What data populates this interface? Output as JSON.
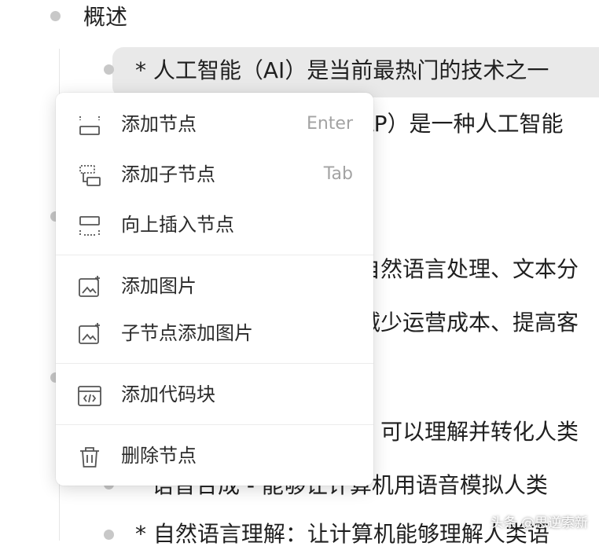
{
  "outline": {
    "title": "概述",
    "lines": [
      "* 人工智能（AI）是当前最热门的技术之一",
      "LP）是一种人工智能",
      "自然语言处理、文本分",
      "减少运营成本、提高客",
      "，可以理解并转化人类",
      "语音合成 - 能够让计算机用语音模拟人类",
      "* 自然语言理解：让计算机能够理解人类语"
    ]
  },
  "menu": {
    "items": [
      {
        "label": "添加节点",
        "shortcut": "Enter",
        "icon": "add-node-icon"
      },
      {
        "label": "添加子节点",
        "shortcut": "Tab",
        "icon": "add-child-node-icon"
      },
      {
        "label": "向上插入节点",
        "shortcut": "",
        "icon": "insert-above-icon"
      },
      {
        "label": "添加图片",
        "shortcut": "",
        "icon": "image-icon"
      },
      {
        "label": "子节点添加图片",
        "shortcut": "",
        "icon": "child-image-icon"
      },
      {
        "label": "添加代码块",
        "shortcut": "",
        "icon": "code-block-icon"
      },
      {
        "label": "删除节点",
        "shortcut": "",
        "icon": "trash-icon"
      }
    ]
  },
  "watermark": "头条 @思逆索新"
}
